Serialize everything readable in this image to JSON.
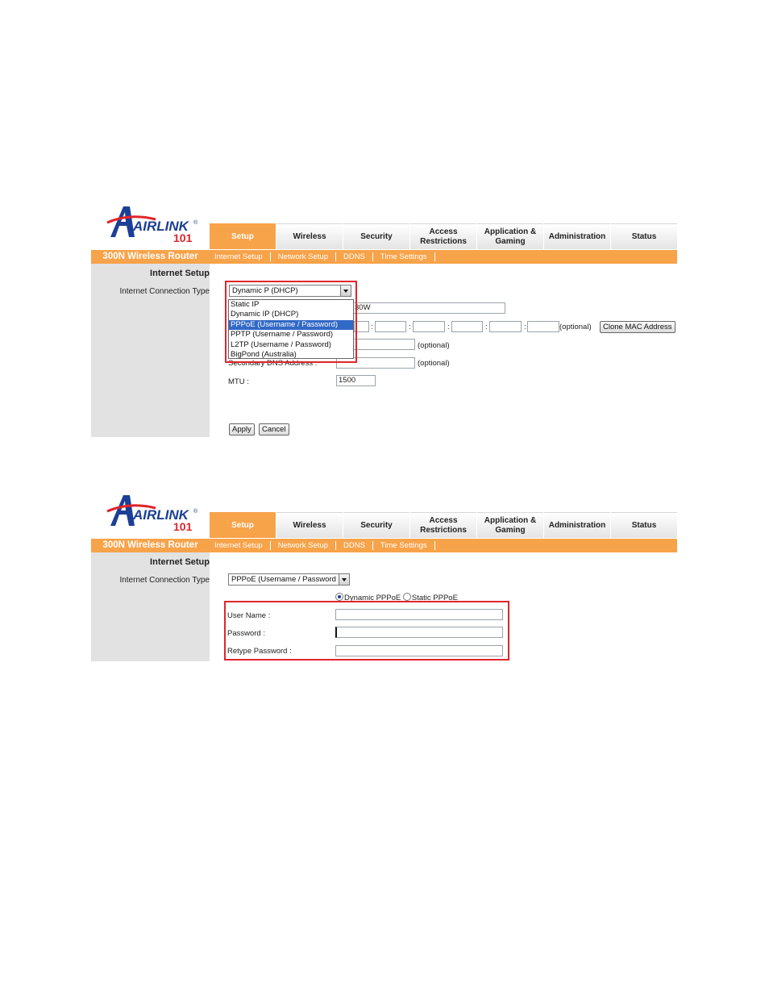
{
  "brand": {
    "name": "AIRLINK",
    "number": "101",
    "registered": "®",
    "subtitle": "300N Wireless Router"
  },
  "tabs": [
    "Setup",
    "Wireless",
    "Security",
    "Access Restrictions",
    "Application & Gaming",
    "Administration",
    "Status"
  ],
  "active_tab": "Setup",
  "subnav": [
    "Internet Setup",
    "Network Setup",
    "DDNS",
    "Time Settings"
  ],
  "sidebar": {
    "title": "Internet Setup",
    "label": "Internet Connection Type"
  },
  "shot1": {
    "select_value": "Dynamic P (DHCP)",
    "options": [
      "Static IP",
      "Dynamic IP (DHCP)",
      "PPPoE (Username / Password)",
      "PPTP (Username / Password)",
      "L2TP (Username / Password)",
      "BigPond (Australia)"
    ],
    "selected_option": "PPPoE (Username / Password)",
    "host_fragment": "30W",
    "mac_separator": ":",
    "optional": "(optional)",
    "clone_mac": "Clone MAC Address",
    "secondary_dns_label": "Secondary DNS Address :",
    "mtu_label": "MTU :",
    "mtu_value": "1500",
    "apply": "Apply",
    "cancel": "Cancel"
  },
  "shot2": {
    "select_value": "PPPoE (Username / Password",
    "radio_dynamic": "Dynamic PPPoE",
    "radio_static": "Static PPPoE",
    "radio_selected": "Dynamic PPPoE",
    "username_label": "User Name :",
    "password_label": "Password :",
    "retype_label": "Retype Password :"
  },
  "colors": {
    "accent": "#f7a34a",
    "highlight_box": "#e0252b",
    "selection": "#3169c6",
    "sidebar_bg": "#e2e2e2"
  }
}
